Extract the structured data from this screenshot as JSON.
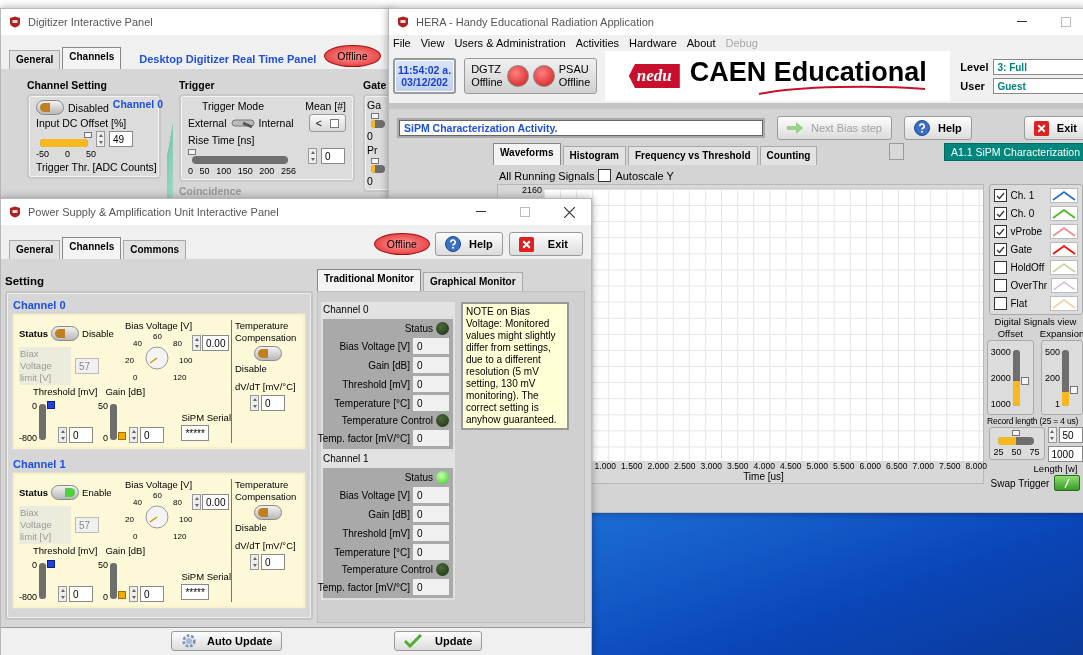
{
  "digitizer": {
    "title": "Digitizer Interactive Panel",
    "tabs": [
      {
        "label": "General",
        "selected": false
      },
      {
        "label": "Channels",
        "selected": true
      }
    ],
    "heading": "Desktop Digitizer Real Time Panel",
    "status_button": "Offline",
    "channel_setting": {
      "title": "Channel Setting",
      "status_label": "Disabled",
      "on": false,
      "channel": "Channel 0",
      "offset_label": "Input DC Offset [%]",
      "level": 0.99,
      "value": "49",
      "ticks": [
        "-50",
        "0",
        "50"
      ],
      "threshold_label": "Trigger Thr. [ADC Counts]"
    },
    "trigger": {
      "title": "Trigger",
      "mode_label": "Trigger Mode",
      "mode_left": "External",
      "mode_right": "Internal",
      "internal": true,
      "mean_label": "Mean [#]",
      "mean_value": "<",
      "rise_label": "Rise Time [ns]",
      "level": 0,
      "value": "0",
      "ticks": [
        "0",
        "50",
        "100",
        "150",
        "200",
        "256"
      ],
      "coincidence": "Coincidence"
    },
    "gate": {
      "title": "Gate",
      "items": [
        {
          "label": "Ga",
          "tick": "0",
          "level": 0.3
        },
        {
          "label": "Pr",
          "tick": "0",
          "level": 0.3
        }
      ]
    }
  },
  "hera": {
    "title": "HERA - Handy Educational Radiation Application",
    "menu": [
      {
        "label": "File",
        "disabled": false
      },
      {
        "label": "View",
        "disabled": false
      },
      {
        "label": "Users & Administration",
        "disabled": false
      },
      {
        "label": "Activities",
        "disabled": false
      },
      {
        "label": "Hardware",
        "disabled": false
      },
      {
        "label": "About",
        "disabled": false
      },
      {
        "label": "Debug",
        "disabled": true
      }
    ],
    "clock": {
      "time": "11:54:02 a.",
      "date": "03/12/202"
    },
    "devices": [
      {
        "name": "DGTZ",
        "status": "Offline",
        "online": false
      },
      {
        "name": "PSAU",
        "status": "Offline",
        "online": false
      }
    ],
    "logo": {
      "badge": "nedu",
      "text": "CAEN Educational"
    },
    "level": {
      "label": "Level",
      "value": "3: Full"
    },
    "user": {
      "label": "User",
      "value": "Guest"
    },
    "activity": "SiPM Characterization Activity.",
    "buttons": [
      {
        "kind": "next",
        "label": "Next Bias step",
        "disabled": true
      },
      {
        "kind": "help",
        "label": "Help",
        "disabled": false
      },
      {
        "kind": "exit",
        "label": "Exit",
        "disabled": false
      }
    ],
    "tabs": [
      {
        "label": "Waveforms",
        "selected": true
      },
      {
        "label": "Histogram",
        "selected": false
      },
      {
        "label": "Frequency vs Threshold",
        "selected": false
      },
      {
        "label": "Counting",
        "selected": false
      }
    ],
    "activity_name": "A1.1 SiPM Characterization",
    "signals_label": "All Running Signals",
    "autoscale": {
      "label": "Autoscale Y",
      "checked": false
    },
    "plot": {
      "y_tick": "2160",
      "x_ticks": [
        "1.000",
        "1.500",
        "2.000",
        "2.500",
        "3.000",
        "3.500",
        "4.000",
        "4.500",
        "5.000",
        "5.500",
        "6.000",
        "6.500",
        "7.000",
        "7.500",
        "8.000"
      ],
      "xlabel": "Time [us]"
    },
    "signals": [
      {
        "label": "Ch. 1",
        "checked": true,
        "color": "#1f6fc0"
      },
      {
        "label": "Ch. 0",
        "checked": true,
        "color": "#3cb818"
      },
      {
        "label": "vProbe",
        "checked": true,
        "color": "#f08a8a"
      },
      {
        "label": "Gate",
        "checked": true,
        "color": "#ff0000"
      },
      {
        "label": "HoldOff",
        "checked": false,
        "color": "#cfcfa8"
      },
      {
        "label": "OverThr",
        "checked": false,
        "color": "#d6b8ec"
      },
      {
        "label": "Flat",
        "checked": false,
        "color": "#f0d2a0"
      }
    ],
    "digital_view": {
      "title": "Digital Signals view",
      "offset": {
        "label": "Offset",
        "ticks": [
          "3000",
          "2000",
          "1000"
        ],
        "level": 0.45
      },
      "expansion": {
        "label": "Expansion",
        "ticks": [
          "500",
          "200",
          "1"
        ],
        "level": 0.25
      }
    },
    "record_length": {
      "label": "Record length (25 = 4 us)",
      "ticks": [
        "25",
        "50",
        "75"
      ],
      "level": 0.5,
      "value": "50",
      "samples": "1000",
      "samples_label": "Length [w]"
    },
    "swap_trigger": {
      "label": "Swap Trigger",
      "on": true
    }
  },
  "psu": {
    "title": "Power Supply & Amplification Unit Interactive Panel",
    "tabs": [
      {
        "label": "General",
        "selected": false
      },
      {
        "label": "Channels",
        "selected": true
      },
      {
        "label": "Commons",
        "selected": false
      }
    ],
    "status_button": "Offline",
    "buttons": [
      {
        "kind": "help",
        "label": "Help"
      },
      {
        "kind": "exit",
        "label": "Exit"
      }
    ],
    "setting_title": "Setting",
    "channels": [
      {
        "name": "Channel 0",
        "status_label": "Status",
        "enabled": false,
        "state_text": "Disable",
        "bias_label": "Bias Voltage [V]",
        "dial_ticks": [
          "0",
          "20",
          "40",
          "60",
          "80",
          "100",
          "120"
        ],
        "bias_value": "0.00",
        "limit_label": "Biax Voltage limit [V]",
        "limit_value": "57",
        "threshold": {
          "label": "Threshold [mV]",
          "ticks": [
            "0",
            "-800"
          ],
          "level": 1,
          "value": "0"
        },
        "gain": {
          "label": "Gain [dB]",
          "ticks": [
            "50",
            "0"
          ],
          "level": 0,
          "value": "0"
        },
        "serial_label": "SiPM Serial",
        "serial_value": "*****",
        "tc_label": "Temperature Compensation",
        "tc_on": false,
        "tc_text": "Disable",
        "dvdt_label": "dV/dT [mV/°C]",
        "dvdt_value": "0"
      },
      {
        "name": "Channel 1",
        "status_label": "Status",
        "enabled": true,
        "state_text": "Enable",
        "bias_label": "Bias Voltage [V]",
        "dial_ticks": [
          "0",
          "20",
          "40",
          "60",
          "80",
          "100",
          "120"
        ],
        "bias_value": "0.00",
        "limit_label": "Biax Voltage limit [V]",
        "limit_value": "57",
        "threshold": {
          "label": "Threshold [mV]",
          "ticks": [
            "0",
            "-800"
          ],
          "level": 1,
          "value": "0"
        },
        "gain": {
          "label": "Gain [dB]",
          "ticks": [
            "50",
            "0"
          ],
          "level": 0,
          "value": "0"
        },
        "serial_label": "SiPM Serial",
        "serial_value": "*****",
        "tc_label": "Temperature Compensation",
        "tc_on": false,
        "tc_text": "Disable",
        "dvdt_label": "dV/dT [mV/°C]",
        "dvdt_value": "0"
      }
    ],
    "monitor_tabs": [
      {
        "label": "Traditional Monitor",
        "selected": true
      },
      {
        "label": "Graphical Monitor",
        "selected": false
      }
    ],
    "monitor_channels": [
      {
        "name": "Channel 0",
        "status_label": "Status",
        "status_on": false,
        "rows": [
          {
            "label": "Bias Voltage [V]",
            "value": "0"
          },
          {
            "label": "Gain [dB]",
            "value": "0"
          },
          {
            "label": "Threshold [mV]",
            "value": "0"
          },
          {
            "label": "Temperature [°C]",
            "value": "0"
          }
        ],
        "tc_label": "Temperature Control",
        "tc_on": false,
        "factor_label": "Temp. factor [mV/°C]",
        "factor_value": "0"
      },
      {
        "name": "Channel 1",
        "status_label": "Status",
        "status_on": true,
        "rows": [
          {
            "label": "Bias Voltage [V]",
            "value": "0"
          },
          {
            "label": "Gain [dB]",
            "value": "0"
          },
          {
            "label": "Threshold [mV]",
            "value": "0"
          },
          {
            "label": "Temperature [°C]",
            "value": "0"
          }
        ],
        "tc_label": "Temperature Control",
        "tc_on": false,
        "factor_label": "Temp. factor [mV/°C]",
        "factor_value": "0"
      }
    ],
    "note": "NOTE on Bias Voltage: Monitored values might slightly differ from settings, due to a different resolution (5 mV setting, 130 mV monitoring). The correct setting is anyhow guaranteed.",
    "bottom_buttons": [
      {
        "kind": "auto",
        "label": "Auto Update"
      },
      {
        "kind": "update",
        "label": "Update"
      }
    ]
  }
}
